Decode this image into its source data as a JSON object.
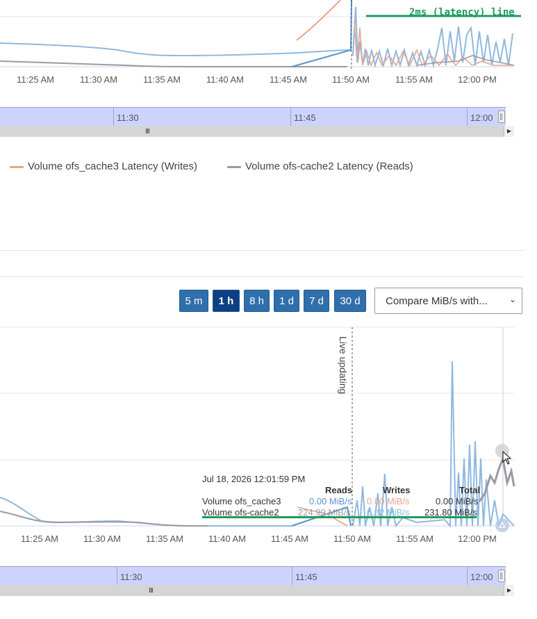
{
  "top_chart": {
    "x_ticks": [
      "11:25 AM",
      "11:30 AM",
      "11:35 AM",
      "11:40 AM",
      "11:45 AM",
      "11:50 AM",
      "11:55 AM",
      "12:00 PM"
    ],
    "threshold_label": "2ms (latency) line",
    "colors": {
      "threshold": "#1e9b5a",
      "reads_cache3": "#6b9fcf",
      "writes_cache3": "#e6a58f",
      "reads_cache2": "#9a9aa3",
      "blue_light": "#8fb8df"
    }
  },
  "top_navigator": {
    "labels": [
      "11:30",
      "11:45",
      "12:00"
    ]
  },
  "legend": {
    "items": [
      {
        "label": "Volume ofs_cache3 Latency (Writes)",
        "color": "#e6a58f"
      },
      {
        "label": "Volume ofs-cache2 Latency (Reads)",
        "color": "#9a9aa3"
      }
    ]
  },
  "toolbar": {
    "range_buttons": [
      {
        "label": "5 m",
        "active": false
      },
      {
        "label": "1 h",
        "active": true
      },
      {
        "label": "8 h",
        "active": false
      },
      {
        "label": "1 d",
        "active": false
      },
      {
        "label": "7 d",
        "active": false
      },
      {
        "label": "30 d",
        "active": false
      }
    ],
    "compare_select": {
      "value": "Compare MiB/s with..."
    }
  },
  "bottom_chart": {
    "x_ticks": [
      "11:25 AM",
      "11:30 AM",
      "11:35 AM",
      "11:40 AM",
      "11:45 AM",
      "11:50 AM",
      "11:55 AM",
      "12:00 PM"
    ],
    "live_label": "Live updating",
    "tooltip": {
      "timestamp": "Jul 18, 2026 12:01:59 PM",
      "headers": {
        "reads": "Reads",
        "writes": "Writes",
        "total": "Total"
      },
      "rows": [
        {
          "name": "Volume ofs_cache3",
          "reads": "0.00 MiB/s",
          "writes": "0.00 MiB/s",
          "total": "0.00 MiB/s"
        },
        {
          "name": "Volume ofs-cache2",
          "reads": "224.99 MiB/s",
          "writes": "6.82 MiB/s",
          "total": "231.80 MiB/s"
        }
      ]
    }
  },
  "bottom_navigator": {
    "labels": [
      "11:30",
      "11:45",
      "12:00"
    ]
  }
}
